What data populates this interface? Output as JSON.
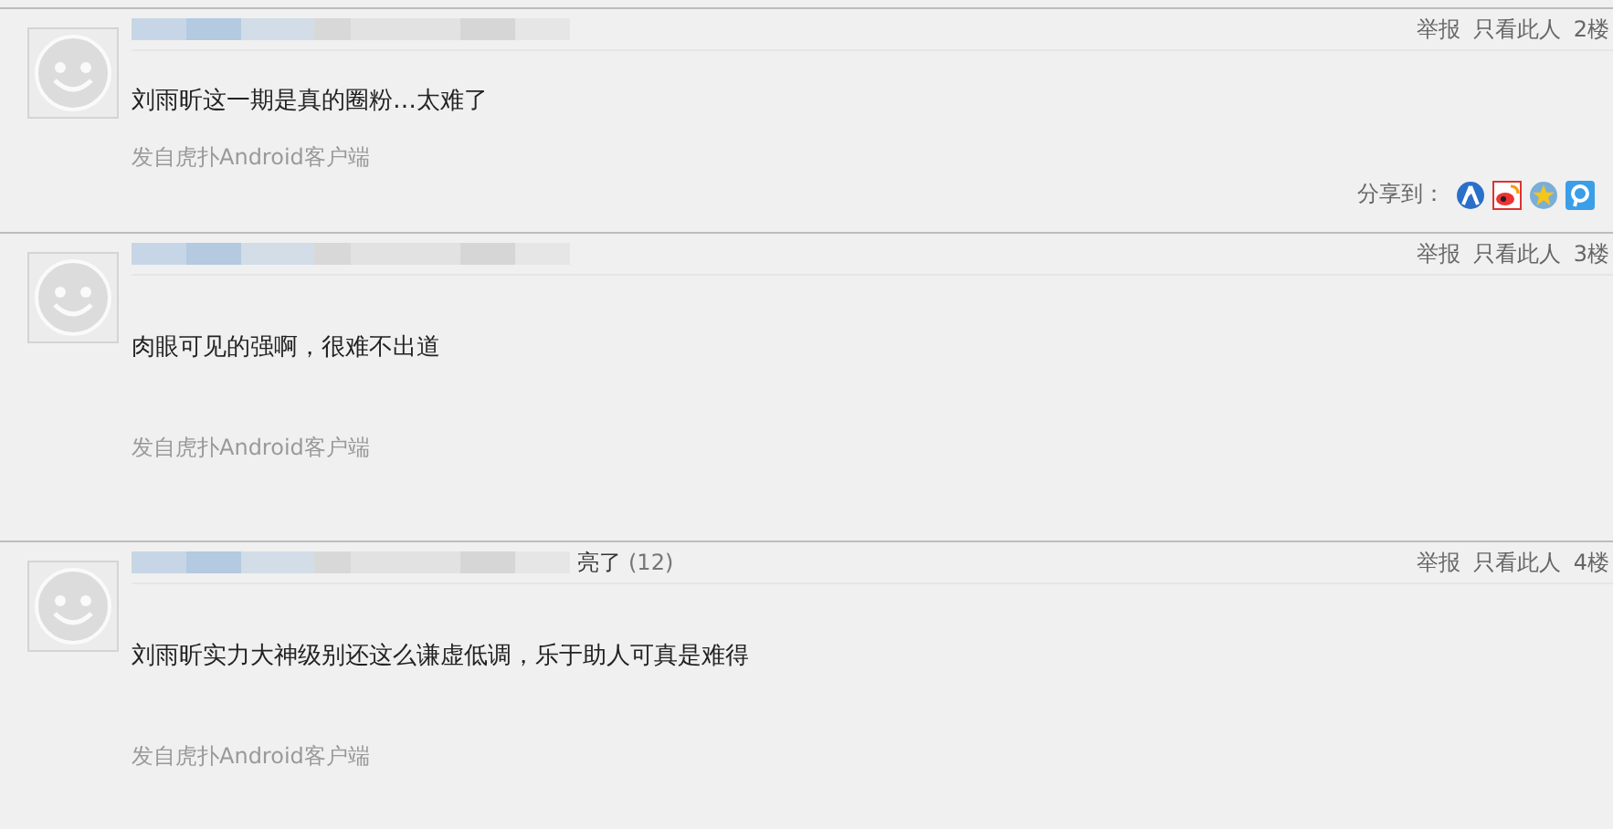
{
  "posts": [
    {
      "actions": [
        "举报",
        "只看此人"
      ],
      "floor": "2楼",
      "content": "刘雨昕这一期是真的圈粉…太难了",
      "source": "发自虎扑Android客户端",
      "share": {
        "label": "分享到："
      }
    },
    {
      "actions": [
        "举报",
        "只看此人"
      ],
      "floor": "3楼",
      "content": "肉眼可见的强啊，很难不出道",
      "source": "发自虎扑Android客户端"
    },
    {
      "actions": [
        "举报",
        "只看此人"
      ],
      "floor": "4楼",
      "light": {
        "label": "亮了",
        "count": "(12)"
      },
      "content": "刘雨昕实力大神级别还这么谦虚低调，乐于助人可真是难得",
      "source": "发自虎扑Android客户端"
    }
  ]
}
